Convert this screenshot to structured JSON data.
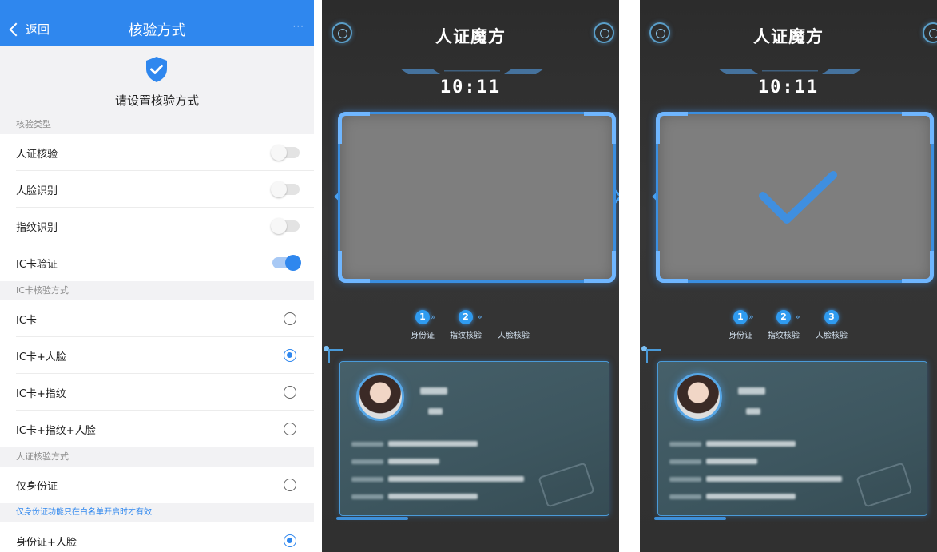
{
  "settings": {
    "nav": {
      "back_label": "返回",
      "title": "核验方式",
      "more": "···"
    },
    "header_prompt": "请设置核验方式",
    "sections": {
      "verify_type": "核验类型",
      "ic_mode": "IC卡核验方式",
      "id_mode": "人证核验方式",
      "note": "仅身份证功能只在白名单开启时才有效"
    },
    "toggles": [
      {
        "label": "人证核验",
        "on": false
      },
      {
        "label": "人脸识别",
        "on": false
      },
      {
        "label": "指纹识别",
        "on": false
      },
      {
        "label": "IC卡验证",
        "on": true
      }
    ],
    "ic_options": [
      {
        "label": "IC卡",
        "selected": false
      },
      {
        "label": "IC卡+人脸",
        "selected": true
      },
      {
        "label": "IC卡+指纹",
        "selected": false
      },
      {
        "label": "IC卡+指纹+人脸",
        "selected": false
      }
    ],
    "id_options": [
      {
        "label": "仅身份证",
        "selected": false
      },
      {
        "label": "身份证+人脸",
        "selected": true
      }
    ],
    "accent_color": "#2f87ee"
  },
  "kiosk": {
    "title": "人证魔方",
    "time": "10:11",
    "steps": [
      {
        "num": "1",
        "label": "身份证"
      },
      {
        "num": "2",
        "label": "指纹核验"
      },
      {
        "num": "3",
        "label": "人脸核验"
      }
    ],
    "step_separator": "»"
  }
}
